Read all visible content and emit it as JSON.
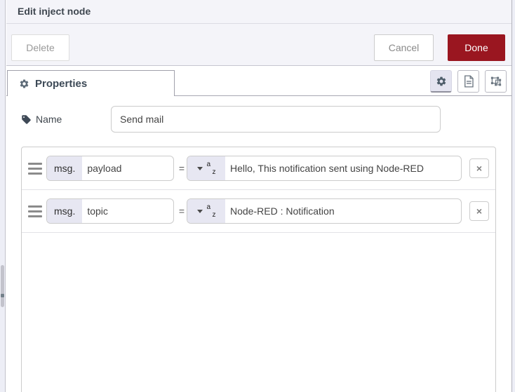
{
  "window": {
    "title": "Edit inject node"
  },
  "toolbar": {
    "delete_label": "Delete",
    "cancel_label": "Cancel",
    "done_label": "Done"
  },
  "tab_bar": {
    "properties_label": "Properties",
    "icon_buttons": [
      {
        "name": "gear",
        "active": true
      },
      {
        "name": "description-doc",
        "active": false
      },
      {
        "name": "node-appearance-frame",
        "active": false
      }
    ]
  },
  "form": {
    "name_label": "Name",
    "name_value": "Send mail",
    "az_top": "a",
    "az_bottom": "z",
    "remove_label": "×",
    "rows": [
      {
        "prefix": "msg.",
        "property": "payload",
        "operator": "=",
        "type": "string",
        "value": "Hello, This notification sent using Node-RED"
      },
      {
        "prefix": "msg.",
        "property": "topic",
        "operator": "=",
        "type": "string",
        "value": "Node-RED : Notification"
      }
    ]
  },
  "colors": {
    "done_button_bg": "#9a1620",
    "typed_input_bg": "#e7e7f2",
    "header_bg": "#f4f4f9",
    "border": "#cccccc"
  }
}
